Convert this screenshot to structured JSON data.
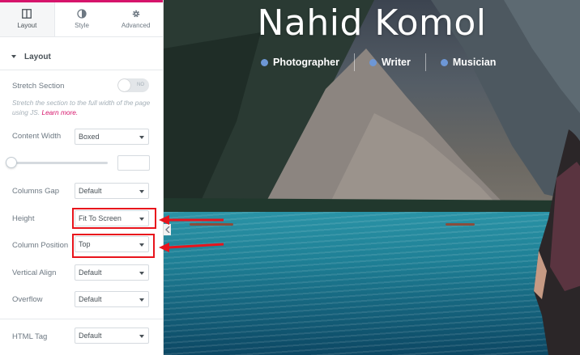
{
  "panel": {
    "tabs": [
      {
        "label": "Layout",
        "icon": "layout-icon",
        "active": true
      },
      {
        "label": "Style",
        "icon": "style-icon",
        "active": false
      },
      {
        "label": "Advanced",
        "icon": "gear-icon",
        "active": false
      }
    ],
    "section_title": "Layout",
    "stretch_section": {
      "label": "Stretch Section",
      "toggle_text": "NO"
    },
    "stretch_desc": "Stretch the section to the full width of the page using JS.",
    "learn_more": "Learn more.",
    "content_width": {
      "label": "Content Width",
      "value": "Boxed"
    },
    "columns_gap": {
      "label": "Columns Gap",
      "value": "Default"
    },
    "height": {
      "label": "Height",
      "value": "Fit To Screen"
    },
    "column_position": {
      "label": "Column Position",
      "value": "Top"
    },
    "vertical_align": {
      "label": "Vertical Align",
      "value": "Default"
    },
    "overflow": {
      "label": "Overflow",
      "value": "Default"
    },
    "html_tag": {
      "label": "HTML Tag",
      "value": "Default"
    }
  },
  "preview": {
    "name": "Nahid Komol",
    "roles": [
      "Photographer",
      "Writer",
      "Musician"
    ]
  },
  "colors": {
    "accent": "#d6146b",
    "highlight": "#e8141c",
    "role_dot": "#6d97d6"
  }
}
